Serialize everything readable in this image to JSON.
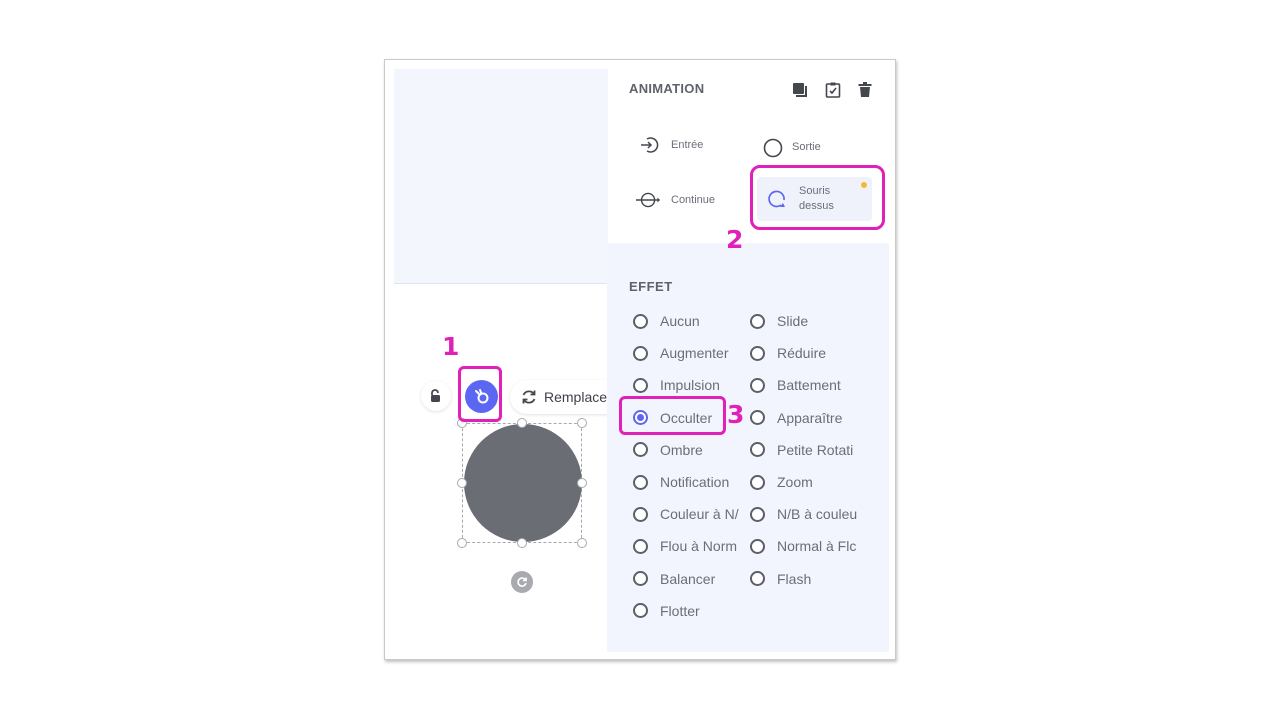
{
  "animation_panel": {
    "title": "ANIMATION",
    "header_icons": [
      "duplicate-icon",
      "paste-icon",
      "trash-icon"
    ],
    "triggers": [
      {
        "label": "Entrée",
        "icon": "enter-icon",
        "selected": false
      },
      {
        "label": "Sortie",
        "icon": "exit-circle-icon",
        "selected": false
      },
      {
        "label": "Continue",
        "icon": "continuous-icon",
        "selected": false
      },
      {
        "label_line1": "Souris",
        "label_line2": "dessus",
        "icon": "hover-loop-icon",
        "selected": true,
        "indicator": "orange-dot"
      }
    ]
  },
  "effect_panel": {
    "title": "EFFET",
    "left_column": [
      "Aucun",
      "Augmenter",
      "Impulsion",
      "Occulter",
      "Ombre",
      "Notification",
      "Couleur à N/",
      "Flou à Norm",
      "Balancer",
      "Flotter"
    ],
    "right_column": [
      "Slide",
      "Réduire",
      "Battement",
      "Apparaître",
      "Petite Rotati",
      "Zoom",
      "N/B à couleu",
      "Normal à Flc",
      "Flash"
    ],
    "selected": "Occulter"
  },
  "toolbar": {
    "replace_label": "Remplace",
    "lock_icon": "unlock-hand-icon",
    "animate_icon": "animate-icon"
  },
  "annotations": {
    "one": "1",
    "two": "2",
    "three": "3"
  },
  "colors": {
    "accent": "#5b67f2",
    "annotation": "#e020b8",
    "indicator": "#f5b82e",
    "shape": "#6b6d75",
    "panel_bg": "#f2f5fd"
  }
}
